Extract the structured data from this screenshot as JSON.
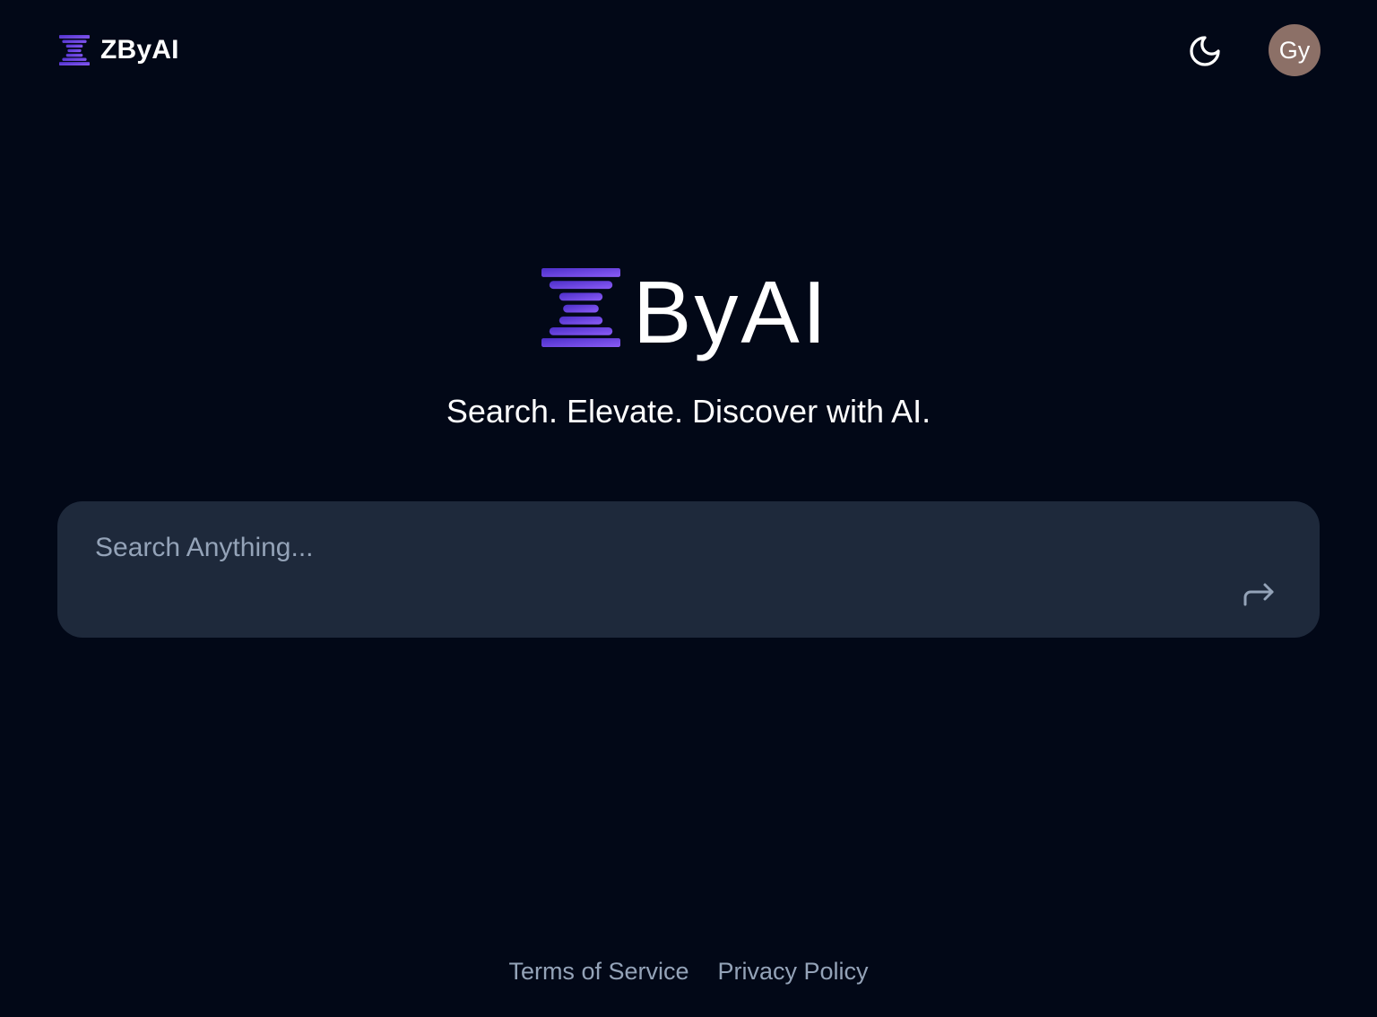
{
  "header": {
    "brand_name": "ZByAI",
    "theme_toggle_icon": "moon-icon",
    "avatar_initials": "Gy"
  },
  "hero": {
    "wordmark": "ByAI",
    "tagline": "Search. Elevate. Discover with AI."
  },
  "search": {
    "placeholder": "Search Anything...",
    "value": "",
    "submit_icon": "forward-arrow-icon"
  },
  "footer": {
    "links": [
      "Terms of Service",
      "Privacy Policy"
    ]
  },
  "colors": {
    "background": "#020817",
    "search_surface": "#1e293b",
    "logo_gradient_start": "#5b3fd6",
    "logo_gradient_end": "#8b5cf6",
    "avatar_bg": "#8c7067",
    "muted_text": "#94a3b8"
  }
}
